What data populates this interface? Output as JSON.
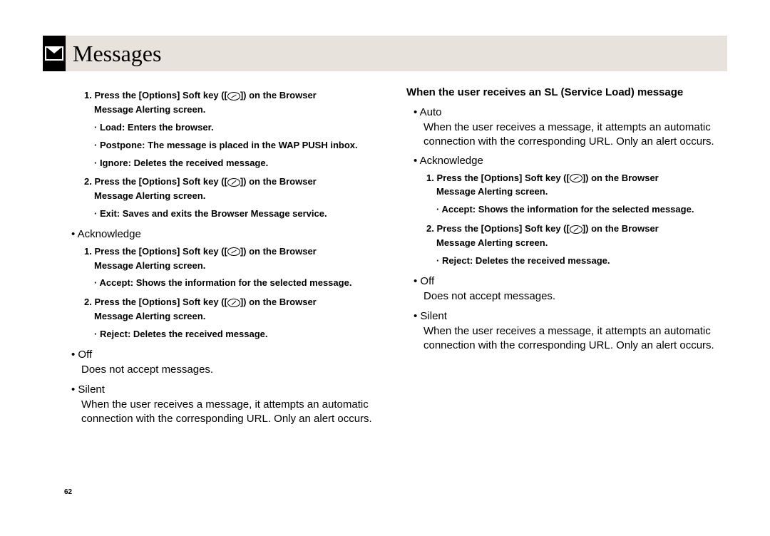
{
  "header": {
    "title": "Messages"
  },
  "page_number": "62",
  "left_col": {
    "step1": {
      "label": "1.",
      "text_a": "Press the [Options] Soft key ([",
      "text_b": "]) on the Browser",
      "text_c": "Message Alerting screen.",
      "sub1": "· Load: Enters the browser.",
      "sub2": "· Postpone: The message is placed in the WAP PUSH inbox.",
      "sub3": "· Ignore: Deletes the received message."
    },
    "step2": {
      "label": "2.",
      "text_a": "Press the [Options] Soft key ([",
      "text_b": "]) on the Browser",
      "text_c": "Message Alerting screen.",
      "sub1": "· Exit: Saves and exits the Browser Message service."
    },
    "ack": {
      "title": "• Acknowledge",
      "step1": {
        "label": "1.",
        "text_a": "Press the [Options] Soft key ([",
        "text_b": "]) on the Browser",
        "text_c": "Message Alerting screen.",
        "sub1": "· Accept: Shows the information for the selected message."
      },
      "step2": {
        "label": "2.",
        "text_a": "Press the [Options] Soft key ([",
        "text_b": "]) on the Browser",
        "text_c": "Message Alerting screen.",
        "sub1": "· Reject: Deletes the received message."
      }
    },
    "off": {
      "title": "• Off",
      "text": "Does not accept messages."
    },
    "silent": {
      "title": "• Silent",
      "text": "When the user receives a message, it attempts an automatic connection with the corresponding URL. Only an alert occurs."
    }
  },
  "right_col": {
    "heading": "When the user receives an SL (Service Load) message",
    "auto": {
      "title": "• Auto",
      "text": "When the user receives a message, it attempts an automatic connection with the corresponding URL. Only an alert occurs."
    },
    "ack": {
      "title": "• Acknowledge",
      "step1": {
        "label": "1.",
        "text_a": "Press the [Options] Soft key ([",
        "text_b": "]) on the Browser",
        "text_c": "Message Alerting screen.",
        "sub1": "· Accept: Shows the information for the selected message."
      },
      "step2": {
        "label": "2.",
        "text_a": "Press the [Options] Soft key ([",
        "text_b": "]) on the Browser",
        "text_c": "Message Alerting screen.",
        "sub1": "· Reject: Deletes the received message."
      }
    },
    "off": {
      "title": "• Off",
      "text": "Does not accept messages."
    },
    "silent": {
      "title": "• Silent",
      "text": "When the user receives a message, it attempts an automatic connection with the corresponding URL. Only an alert occurs."
    }
  }
}
